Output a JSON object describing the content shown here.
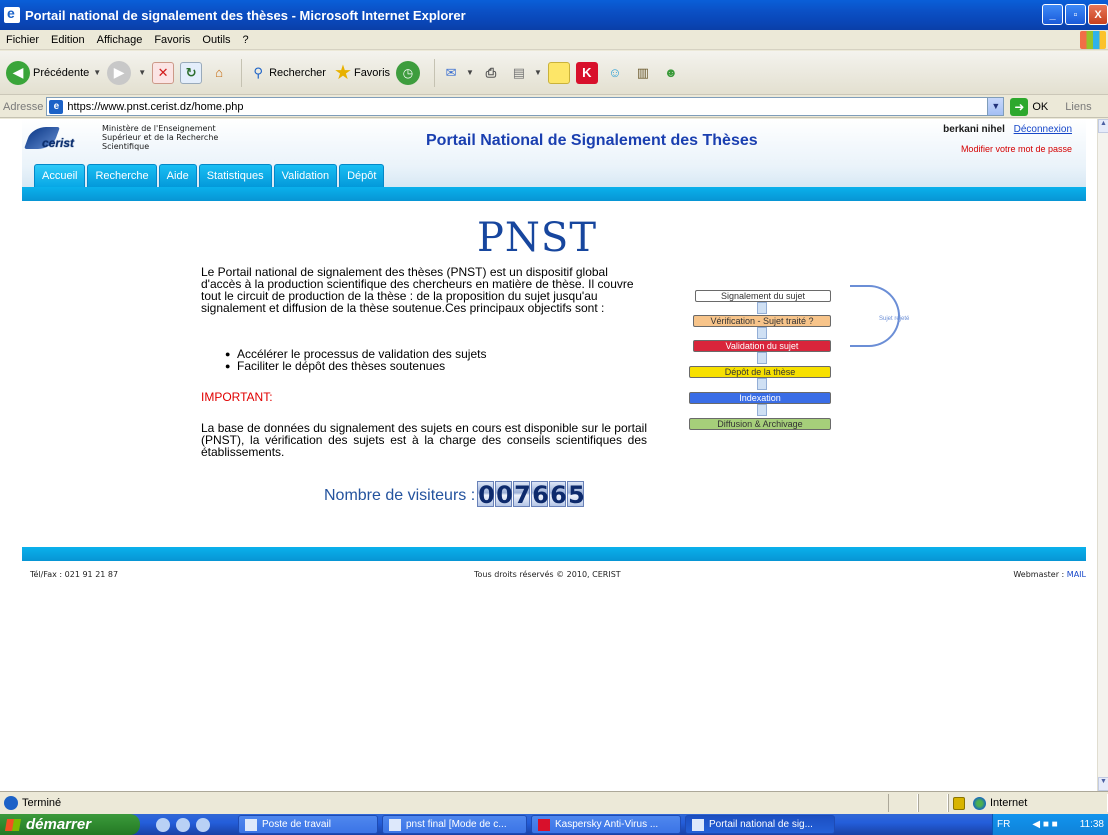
{
  "window": {
    "title": "Portail national de signalement des thèses - Microsoft Internet Explorer",
    "min": "_",
    "max": "▫",
    "close": "X"
  },
  "menu": [
    "Fichier",
    "Edition",
    "Affichage",
    "Favoris",
    "Outils",
    "?"
  ],
  "toolbar": {
    "back_label": "Précédente",
    "search_label": "Rechercher",
    "favorites_label": "Favoris"
  },
  "address": {
    "label": "Adresse",
    "url": "https://www.pnst.cerist.dz/home.php",
    "go_label": "OK",
    "links_label": "Liens"
  },
  "site": {
    "logo_text": "cerist",
    "ministry": "Ministère de l'Enseignement\nSupérieur et de la Recherche\nScientifique",
    "title": "Portail National de Signalement des Thèses",
    "user_name": "berkani nihel",
    "logout": "Déconnexion",
    "change_password": "Modifier votre mot de passe",
    "tabs": [
      "Accueil",
      "Recherche",
      "Aide",
      "Statistiques",
      "Validation",
      "Dépôt"
    ],
    "active_tab": "Accueil"
  },
  "main": {
    "heading": "PNST",
    "intro": "Le Portail national de signalement des thèses (PNST) est un dispositif global d'accès à la production scientifique des chercheurs en matière de thèse. Il couvre tout le circuit de production de la thèse : de la proposition du sujet jusqu'au signalement et diffusion de la thèse soutenue.Ces principaux objectifs sont :",
    "bullets": [
      "Accélérer le processus de validation des sujets",
      "Faciliter le dépôt des thèses soutenues"
    ],
    "important": "IMPORTANT:",
    "base_text": "La base de données du signalement des sujets en cours est disponible sur le portail (PNST), la vérification des sujets est à la charge des conseils scientifiques des établissements.",
    "visitors_label": "Nombre de visiteurs :",
    "visitors_digits": [
      "0",
      "0",
      "7",
      "6",
      "6",
      "5"
    ]
  },
  "flow": {
    "steps": [
      {
        "label": "Signalement du sujet",
        "color": "#ffffff"
      },
      {
        "label": "Vérification - Sujet traité ?",
        "color": "#f7c48a"
      },
      {
        "label": "Validation du sujet",
        "color": "#d9253b"
      },
      {
        "label": "Dépôt de la thèse",
        "color": "#f7e000"
      },
      {
        "label": "Indexation",
        "color": "#3a6de6"
      },
      {
        "label": "Diffusion & Archivage",
        "color": "#a6cf7a"
      }
    ],
    "side_label": "Sujet rejeté"
  },
  "footer": {
    "tel": "Tél/Fax : 021 91 21 87",
    "rights": "Tous droits réservés © 2010, CERIST",
    "webmaster": "Webmaster : ",
    "mail": "MAIL"
  },
  "status": {
    "text": "Terminé",
    "zone": "Internet"
  },
  "taskbar": {
    "start": "démarrer",
    "tasks": [
      "Poste de travail",
      "pnst final [Mode de c...",
      "Kaspersky Anti-Virus ...",
      "Portail national de sig..."
    ],
    "lang": "FR",
    "clock": "11:38"
  }
}
